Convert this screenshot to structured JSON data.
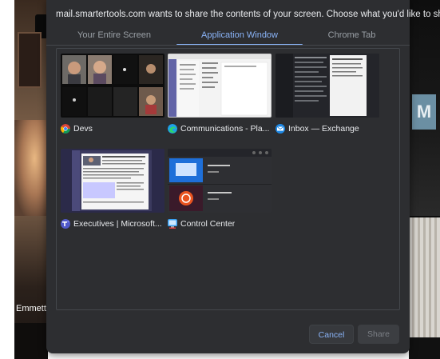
{
  "dialog": {
    "title": "mail.smartertools.com wants to share the contents of your screen. Choose what you'd like to share.",
    "tabs": [
      {
        "label": "Your Entire Screen"
      },
      {
        "label": "Application Window"
      },
      {
        "label": "Chrome Tab"
      }
    ],
    "windows": [
      {
        "label": "Devs",
        "icon": "chrome-icon"
      },
      {
        "label": "Communications - Pla...",
        "icon": "edge-icon"
      },
      {
        "label": "Inbox — Exchange",
        "icon": "mail-icon"
      },
      {
        "label": "Executives | Microsoft...",
        "icon": "teams-icon"
      },
      {
        "label": "Control Center",
        "icon": "control-center-icon"
      }
    ],
    "buttons": {
      "cancel": "Cancel",
      "share": "Share"
    }
  },
  "background": {
    "participant_name": "Emmett",
    "tile_letter": "M"
  },
  "colors": {
    "accent": "#8ab4f8",
    "dialog_bg": "#2d2e31"
  }
}
